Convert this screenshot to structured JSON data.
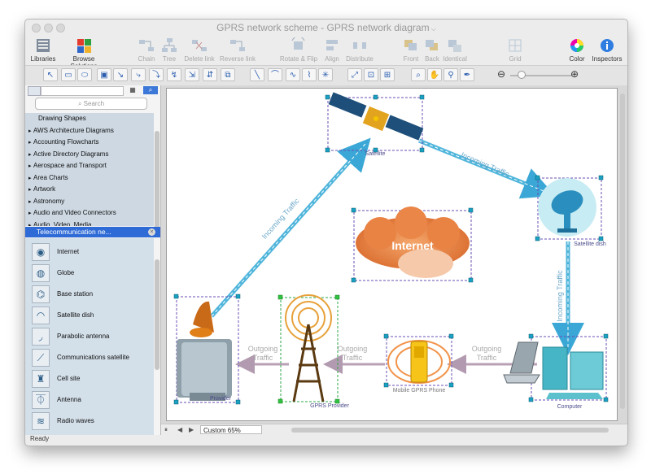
{
  "window": {
    "title": "GPRS network scheme - GPRS network diagram"
  },
  "toolbar": {
    "libraries": "Libraries",
    "browse_solutions": "Browse Solutions",
    "chain": "Chain",
    "tree": "Tree",
    "delete_link": "Delete link",
    "reverse_link": "Reverse link",
    "rotate_flip": "Rotate & Flip",
    "align": "Align",
    "distribute": "Distribute",
    "front": "Front",
    "back": "Back",
    "identical": "Identical",
    "grid": "Grid",
    "color": "Color",
    "inspectors": "Inspectors"
  },
  "sidebar": {
    "search_placeholder": "Search",
    "libraries": [
      "Drawing Shapes",
      "AWS Architecture Diagrams",
      "Accounting Flowcharts",
      "Active Directory Diagrams",
      "Aerospace and Transport",
      "Area Charts",
      "Artwork",
      "Astronomy",
      "Audio and Video Connectors",
      "Audio, Video, Media"
    ],
    "selected_library": "Telecommunication ne...",
    "shapes": [
      "Internet",
      "Globe",
      "Base station",
      "Satellite dish",
      "Parabolic antenna",
      "Communications satellite",
      "Cell site",
      "Antenna",
      "Radio waves"
    ]
  },
  "diagram": {
    "satellite": "Satellite",
    "satellite_dish": "Satellite dish",
    "internet": "Internet",
    "provider": "Provider",
    "gprs_provider": "GPRS Provider",
    "mobile_phone": "Mobile GPRS Phone",
    "computer": "Computer",
    "incoming_traffic": "Incoming Traffic",
    "outgoing": "Outgoing",
    "traffic": "Traffic"
  },
  "bottom": {
    "zoom": "Custom 65%"
  },
  "status": {
    "text": "Ready"
  }
}
